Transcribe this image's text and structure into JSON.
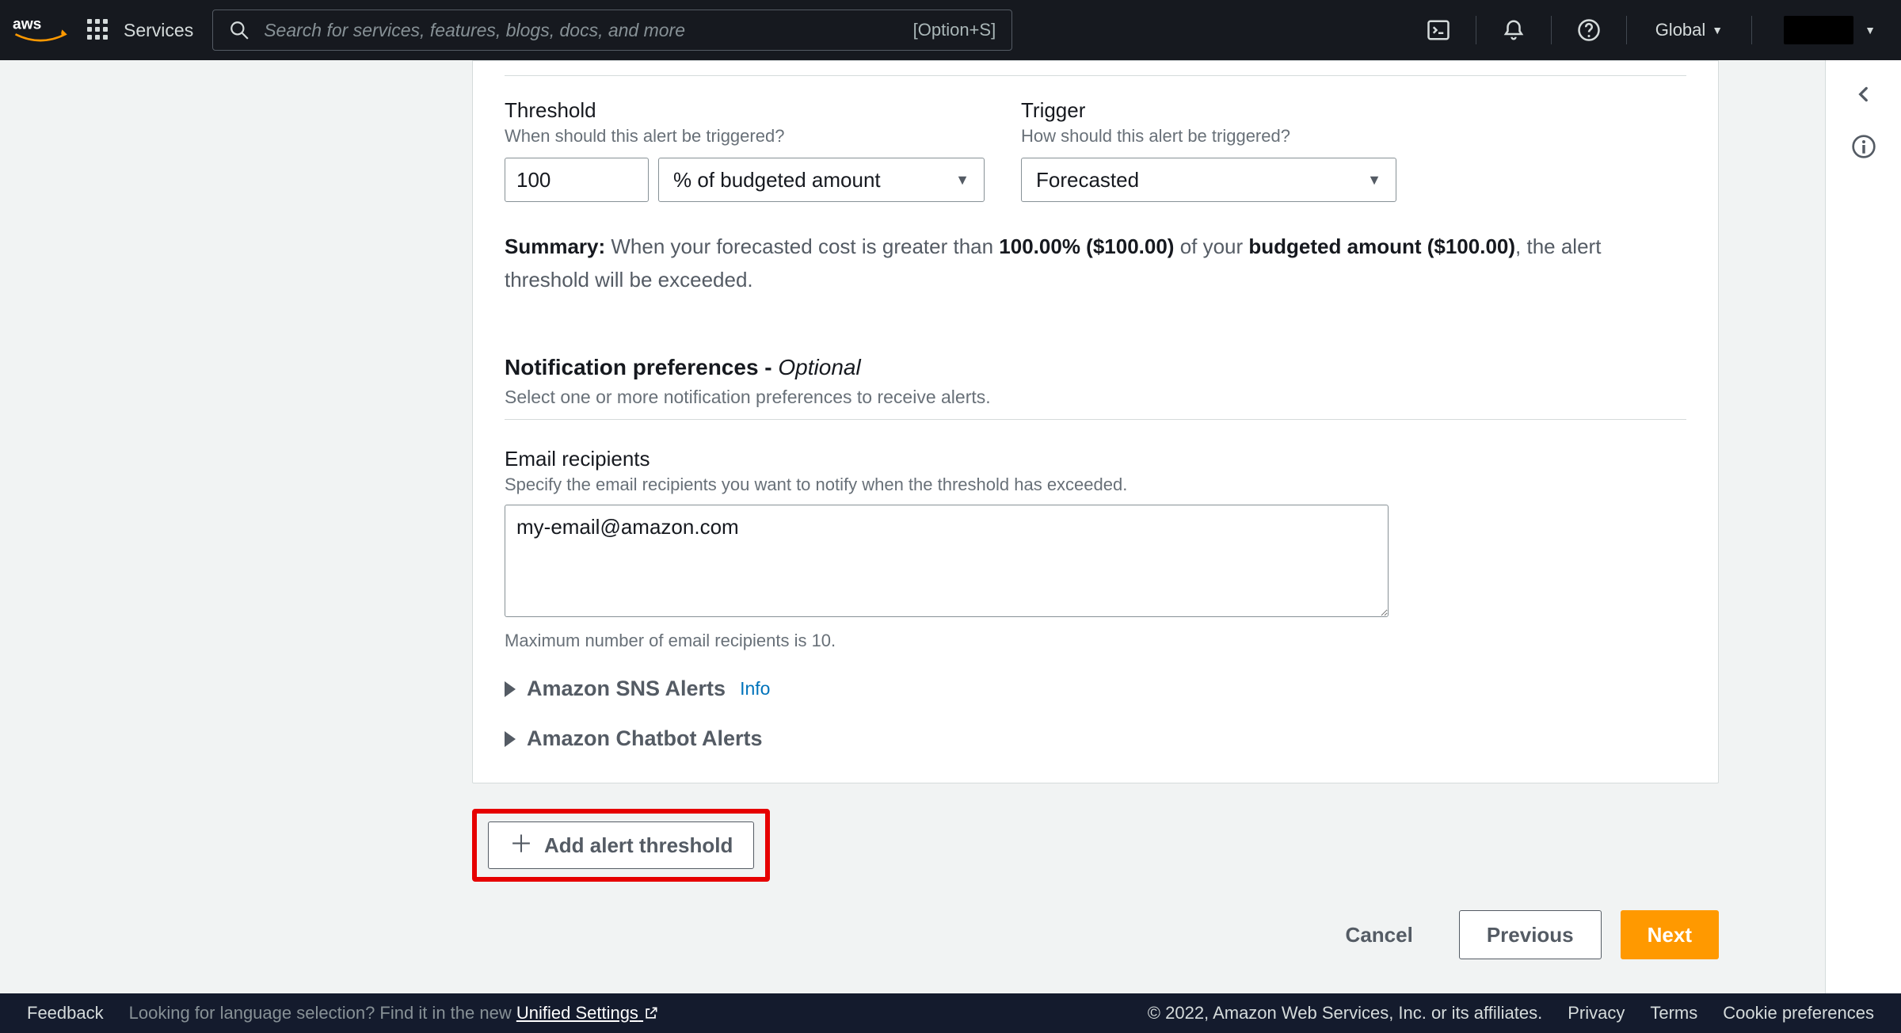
{
  "nav": {
    "services": "Services",
    "search_placeholder": "Search for services, features, blogs, docs, and more",
    "keyhint": "[Option+S]",
    "region": "Global"
  },
  "threshold": {
    "title": "Threshold",
    "sub": "When should this alert be triggered?",
    "value": "100",
    "unit": "% of budgeted amount"
  },
  "trigger": {
    "title": "Trigger",
    "sub": "How should this alert be triggered?",
    "value": "Forecasted"
  },
  "summary": {
    "label": "Summary:",
    "t0": " When your forecasted cost is greater than ",
    "pct": "100.00% ($100.00)",
    "t1": " of your ",
    "amt": "budgeted amount ($100.00)",
    "t2": ", the alert threshold will be exceeded."
  },
  "notif": {
    "title": "Notification preferences - ",
    "opt": "Optional",
    "sub": "Select one or more notification preferences to receive alerts."
  },
  "email": {
    "title": "Email recipients",
    "sub": "Specify the email recipients you want to notify when the threshold has exceeded.",
    "value": "my-email@amazon.com",
    "max": "Maximum number of email recipients is 10."
  },
  "sns": {
    "label": "Amazon SNS Alerts",
    "info": "Info"
  },
  "chatbot": {
    "label": "Amazon Chatbot Alerts"
  },
  "add": "Add alert threshold",
  "buttons": {
    "cancel": "Cancel",
    "prev": "Previous",
    "next": "Next"
  },
  "footer": {
    "feedback": "Feedback",
    "lang_q": "Looking for language selection? Find it in the new ",
    "unified": "Unified Settings",
    "copyright": "© 2022, Amazon Web Services, Inc. or its affiliates.",
    "privacy": "Privacy",
    "terms": "Terms",
    "cookies": "Cookie preferences"
  }
}
